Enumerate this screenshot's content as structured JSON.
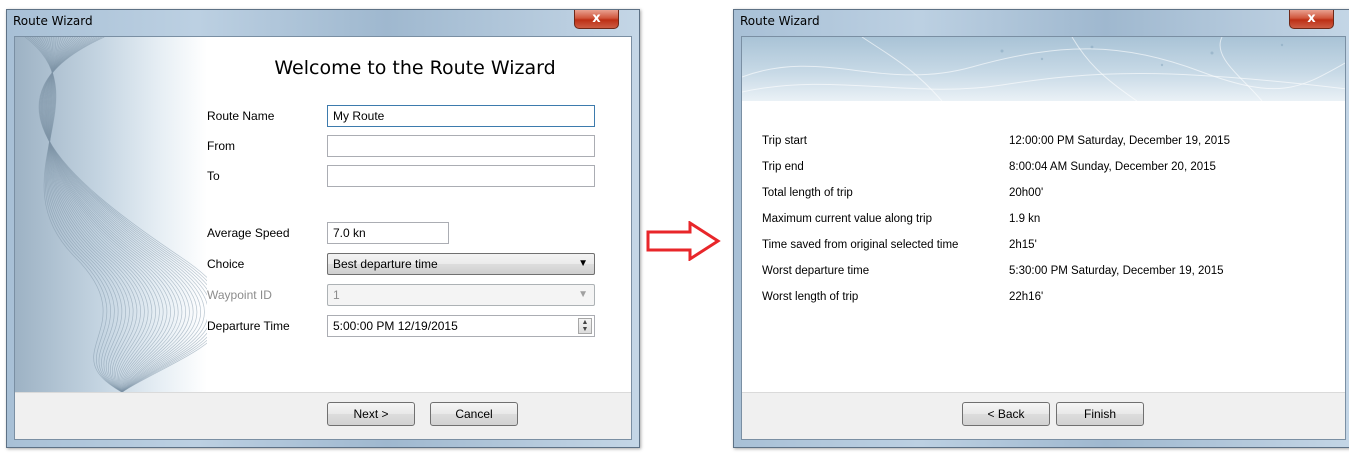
{
  "window1": {
    "title": "Route Wizard",
    "close_label": "x",
    "heading": "Welcome to the Route Wizard",
    "fields": {
      "route_name": {
        "label": "Route Name",
        "value": "My Route"
      },
      "from": {
        "label": "From",
        "value": ""
      },
      "to": {
        "label": "To",
        "value": ""
      },
      "average_speed": {
        "label": "Average Speed",
        "value": "7.0 kn"
      },
      "choice": {
        "label": "Choice",
        "value": "Best departure time"
      },
      "waypoint_id": {
        "label": "Waypoint ID",
        "value": "1"
      },
      "departure_time": {
        "label": "Departure Time",
        "value": "5:00:00 PM  12/19/2015"
      }
    },
    "buttons": {
      "next": "Next >",
      "cancel": "Cancel"
    }
  },
  "window2": {
    "title": "Route Wizard",
    "close_label": "x",
    "summary": [
      {
        "label": "Trip start",
        "value": "12:00:00 PM Saturday, December 19, 2015"
      },
      {
        "label": "Trip end",
        "value": "8:00:04 AM Sunday, December 20, 2015"
      },
      {
        "label": "Total length of trip",
        "value": "20h00'"
      },
      {
        "label": "Maximum current value along trip",
        "value": "1.9 kn"
      },
      {
        "label": "Time saved from original selected time",
        "value": "2h15'"
      },
      {
        "label": "Worst departure time",
        "value": "5:30:00 PM Saturday, December 19, 2015"
      },
      {
        "label": "Worst length of trip",
        "value": "22h16'"
      }
    ],
    "buttons": {
      "back": "< Back",
      "finish": "Finish"
    }
  },
  "colors": {
    "arrow": "#e8262a",
    "close_button": "#c8432a",
    "frame": "#a8c0d6"
  }
}
